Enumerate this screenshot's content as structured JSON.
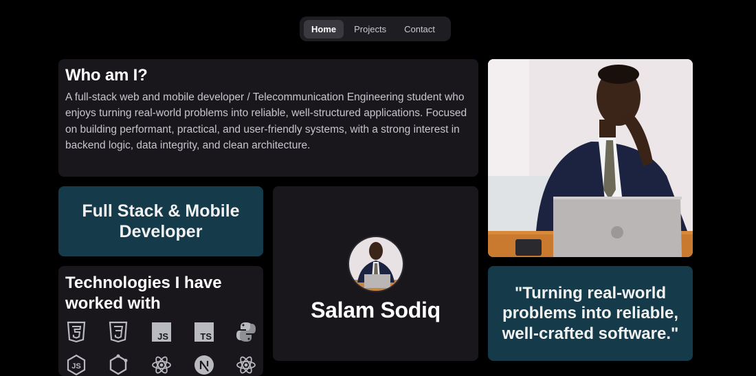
{
  "nav": {
    "items": [
      "Home",
      "Projects",
      "Contact"
    ],
    "active": "Home"
  },
  "about": {
    "title": "Who am I?",
    "text": "A full-stack web and mobile developer / Telecommunication Engineering student who enjoys turning real-world problems into reliable, well-structured applications. Focused on building performant, practical, and user-friendly systems, with a strong interest in backend logic, data integrity, and clean architecture."
  },
  "role": {
    "text": "Full Stack & Mobile Developer"
  },
  "profile": {
    "name": "Salam Sodiq"
  },
  "tech": {
    "title": "Technologies I have worked with",
    "icons": [
      "html5-icon",
      "css3-icon",
      "javascript-icon",
      "typescript-icon",
      "python-icon",
      "nodejs-icon",
      "graphql-icon",
      "react-icon",
      "nextjs-icon",
      "react-native-icon"
    ],
    "js_label": "JS",
    "ts_label": "TS"
  },
  "quote": {
    "text": "\"Turning real-world problems into reliable, well-crafted software.\""
  },
  "colors": {
    "background": "#000000",
    "card": "#19171c",
    "accent_card": "#153a4a",
    "icon": "#b9b9c0"
  }
}
